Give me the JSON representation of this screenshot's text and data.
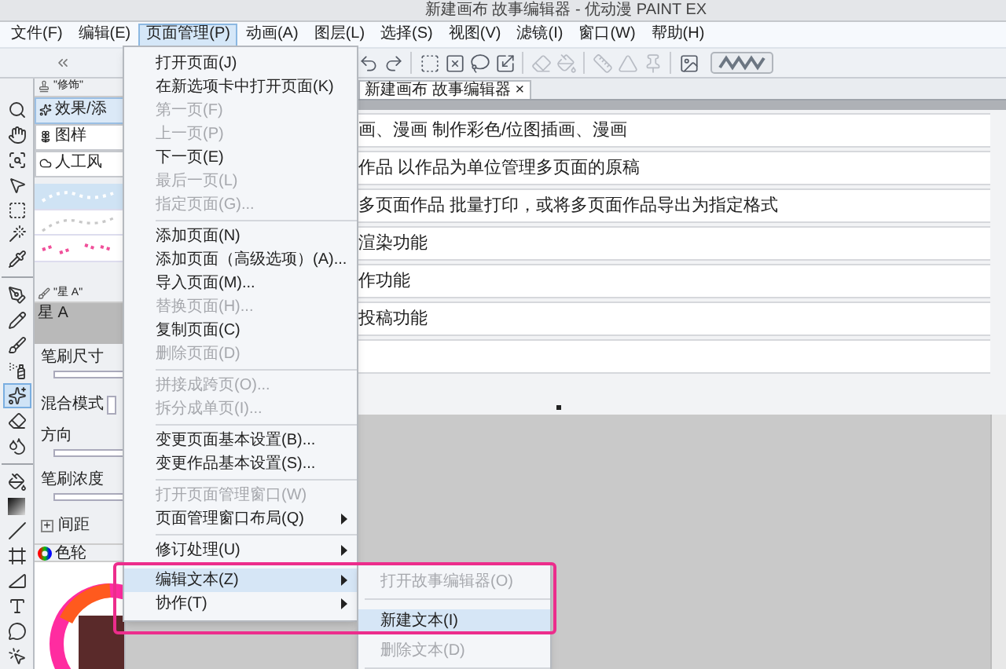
{
  "window": {
    "title": "新建画布 故事编辑器 - 优动漫 PAINT EX"
  },
  "menu_bar": [
    {
      "label": "文件(F)",
      "selected": false
    },
    {
      "label": "编辑(E)",
      "selected": false
    },
    {
      "label": "页面管理(P)",
      "selected": true
    },
    {
      "label": "动画(A)",
      "selected": false
    },
    {
      "label": "图层(L)",
      "selected": false
    },
    {
      "label": "选择(S)",
      "selected": false
    },
    {
      "label": "视图(V)",
      "selected": false
    },
    {
      "label": "滤镜(I)",
      "selected": false
    },
    {
      "label": "窗口(W)",
      "selected": false
    },
    {
      "label": "帮助(H)",
      "selected": false
    }
  ],
  "toolbar": [
    {
      "kind": "undo",
      "disabled": false
    },
    {
      "kind": "redo",
      "disabled": false
    },
    {
      "kind": "separator"
    },
    {
      "kind": "select-all",
      "disabled": false
    },
    {
      "kind": "deselect",
      "disabled": false
    },
    {
      "kind": "lasso",
      "disabled": false
    },
    {
      "kind": "transform",
      "disabled": false
    },
    {
      "kind": "separator"
    },
    {
      "kind": "clear",
      "disabled": true
    },
    {
      "kind": "fill",
      "disabled": true
    },
    {
      "kind": "separator"
    },
    {
      "kind": "ruler",
      "disabled": true
    },
    {
      "kind": "triangle",
      "disabled": true
    },
    {
      "kind": "pin",
      "disabled": true
    },
    {
      "kind": "separator"
    },
    {
      "kind": "image",
      "disabled": false
    }
  ],
  "tools": [
    {
      "kind": "zoom",
      "selected": false
    },
    {
      "kind": "hand",
      "selected": false
    },
    {
      "kind": "zoom-area",
      "selected": false
    },
    {
      "kind": "move",
      "selected": false
    },
    {
      "kind": "rect-select",
      "selected": false
    },
    {
      "kind": "wand",
      "selected": false
    },
    {
      "kind": "eyedropper",
      "selected": false
    },
    {
      "kind": "separator"
    },
    {
      "kind": "pen",
      "selected": false
    },
    {
      "kind": "pencil",
      "selected": false
    },
    {
      "kind": "brush",
      "selected": false
    },
    {
      "kind": "airbrush",
      "selected": false
    },
    {
      "kind": "decoration",
      "selected": true
    },
    {
      "kind": "eraser",
      "selected": false
    },
    {
      "kind": "blend",
      "selected": false
    },
    {
      "kind": "separator"
    },
    {
      "kind": "fill",
      "selected": false
    },
    {
      "kind": "gradient",
      "selected": false
    },
    {
      "kind": "line",
      "selected": false
    },
    {
      "kind": "frame",
      "selected": false
    },
    {
      "kind": "ruler",
      "selected": false
    },
    {
      "kind": "text",
      "selected": false
    },
    {
      "kind": "balloon",
      "selected": false
    },
    {
      "kind": "object",
      "selected": false
    }
  ],
  "sub_tool": {
    "title": "\"修饰\"",
    "tabs": [
      {
        "label": "效果/添",
        "selected": true
      },
      {
        "label": "图样",
        "selected": false
      },
      {
        "label": "人工风",
        "selected": false
      }
    ],
    "brushes": [
      {
        "kind": "dots",
        "selected": true
      },
      {
        "kind": "dotted-curve",
        "selected": false
      },
      {
        "kind": "pink-stars",
        "selected": false
      }
    ]
  },
  "tool_property": {
    "title": "\"星 A\"",
    "preview": "星 A",
    "fields": [
      {
        "kind": "slider",
        "label": "笔刷尺寸"
      },
      {
        "kind": "dropdown",
        "label": "混合模式"
      },
      {
        "kind": "slider",
        "label": "方向"
      },
      {
        "kind": "slider",
        "label": "笔刷浓度"
      },
      {
        "kind": "expander",
        "label": "间距",
        "expander": "+"
      }
    ]
  },
  "color_panel": {
    "tab": "色轮"
  },
  "document_tab": {
    "label": "新建画布 故事编辑器",
    "close": "×"
  },
  "story_rows": [
    "画、漫画 制作彩色/位图插画、漫画",
    "作品 以作品为单位管理多页面的原稿",
    "多页面作品 批量打印，或将多页面作品导出为指定格式",
    "渲染功能",
    "作功能",
    "投稿功能"
  ],
  "page_menu": [
    {
      "kind": "item",
      "label": "打开页面(J)",
      "disabled": false,
      "submenu": false,
      "selected": false
    },
    {
      "kind": "item",
      "label": "在新选项卡中打开页面(K)",
      "disabled": false,
      "submenu": false,
      "selected": false
    },
    {
      "kind": "item",
      "label": "第一页(F)",
      "disabled": true,
      "submenu": false,
      "selected": false
    },
    {
      "kind": "item",
      "label": "上一页(P)",
      "disabled": true,
      "submenu": false,
      "selected": false
    },
    {
      "kind": "item",
      "label": "下一页(E)",
      "disabled": false,
      "submenu": false,
      "selected": false
    },
    {
      "kind": "item",
      "label": "最后一页(L)",
      "disabled": true,
      "submenu": false,
      "selected": false
    },
    {
      "kind": "item",
      "label": "指定页面(G)...",
      "disabled": true,
      "submenu": false,
      "selected": false
    },
    {
      "kind": "separator"
    },
    {
      "kind": "item",
      "label": "添加页面(N)",
      "disabled": false,
      "submenu": false,
      "selected": false
    },
    {
      "kind": "item",
      "label": "添加页面（高级选项）(A)...",
      "disabled": false,
      "submenu": false,
      "selected": false
    },
    {
      "kind": "item",
      "label": "导入页面(M)...",
      "disabled": false,
      "submenu": false,
      "selected": false
    },
    {
      "kind": "item",
      "label": "替换页面(H)...",
      "disabled": true,
      "submenu": false,
      "selected": false
    },
    {
      "kind": "item",
      "label": "复制页面(C)",
      "disabled": false,
      "submenu": false,
      "selected": false
    },
    {
      "kind": "item",
      "label": "删除页面(D)",
      "disabled": true,
      "submenu": false,
      "selected": false
    },
    {
      "kind": "separator"
    },
    {
      "kind": "item",
      "label": "拼接成跨页(O)...",
      "disabled": true,
      "submenu": false,
      "selected": false
    },
    {
      "kind": "item",
      "label": "拆分成单页(I)...",
      "disabled": true,
      "submenu": false,
      "selected": false
    },
    {
      "kind": "separator"
    },
    {
      "kind": "item",
      "label": "变更页面基本设置(B)...",
      "disabled": false,
      "submenu": false,
      "selected": false
    },
    {
      "kind": "item",
      "label": "变更作品基本设置(S)...",
      "disabled": false,
      "submenu": false,
      "selected": false
    },
    {
      "kind": "separator"
    },
    {
      "kind": "item",
      "label": "打开页面管理窗口(W)",
      "disabled": true,
      "submenu": false,
      "selected": false
    },
    {
      "kind": "item",
      "label": "页面管理窗口布局(Q)",
      "disabled": false,
      "submenu": true,
      "selected": false
    },
    {
      "kind": "separator"
    },
    {
      "kind": "item",
      "label": "修订处理(U)",
      "disabled": false,
      "submenu": true,
      "selected": false
    },
    {
      "kind": "item",
      "label": "编辑文本(Z)",
      "disabled": false,
      "submenu": true,
      "selected": true
    },
    {
      "kind": "item",
      "label": "协作(T)",
      "disabled": false,
      "submenu": true,
      "selected": false
    }
  ],
  "text_submenu": [
    {
      "kind": "item",
      "label": "打开故事编辑器(O)",
      "disabled": true,
      "selected": false
    },
    {
      "kind": "separator"
    },
    {
      "kind": "item",
      "label": "新建文本(I)",
      "disabled": false,
      "selected": true
    },
    {
      "kind": "item",
      "label": "删除文本(D)",
      "disabled": true,
      "selected": false
    },
    {
      "kind": "separator"
    }
  ]
}
